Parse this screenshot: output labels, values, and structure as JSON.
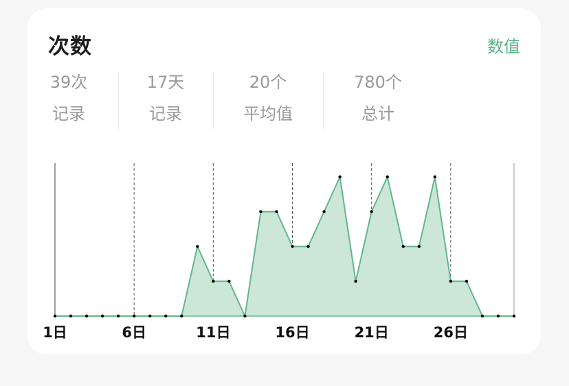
{
  "header": {
    "title": "次数",
    "action_label": "数值"
  },
  "stats": [
    {
      "value": "39次",
      "label": "记录"
    },
    {
      "value": "17天",
      "label": "记录"
    },
    {
      "value": "20个",
      "label": "平均值"
    },
    {
      "value": "780个",
      "label": "总计"
    }
  ],
  "chart_data": {
    "type": "area",
    "x": [
      1,
      2,
      3,
      4,
      5,
      6,
      7,
      8,
      9,
      10,
      11,
      12,
      13,
      14,
      15,
      16,
      17,
      18,
      19,
      20,
      21,
      22,
      23,
      24,
      25,
      26,
      27,
      28,
      29,
      30
    ],
    "values": [
      0,
      0,
      0,
      0,
      0,
      0,
      0,
      0,
      0,
      2,
      1,
      1,
      0,
      3,
      3,
      2,
      2,
      3,
      4,
      1,
      3,
      4,
      2,
      2,
      4,
      1,
      1,
      0,
      0,
      0
    ],
    "tick_labels": [
      "1日",
      "6日",
      "11日",
      "16日",
      "21日",
      "26日"
    ],
    "tick_days": [
      1,
      6,
      11,
      16,
      21,
      26
    ],
    "ylim": [
      0,
      4
    ],
    "grid": "vertical-dashed",
    "colors": {
      "line": "#62b68b",
      "fill": "#cce6d8",
      "marker": "#000000"
    }
  }
}
